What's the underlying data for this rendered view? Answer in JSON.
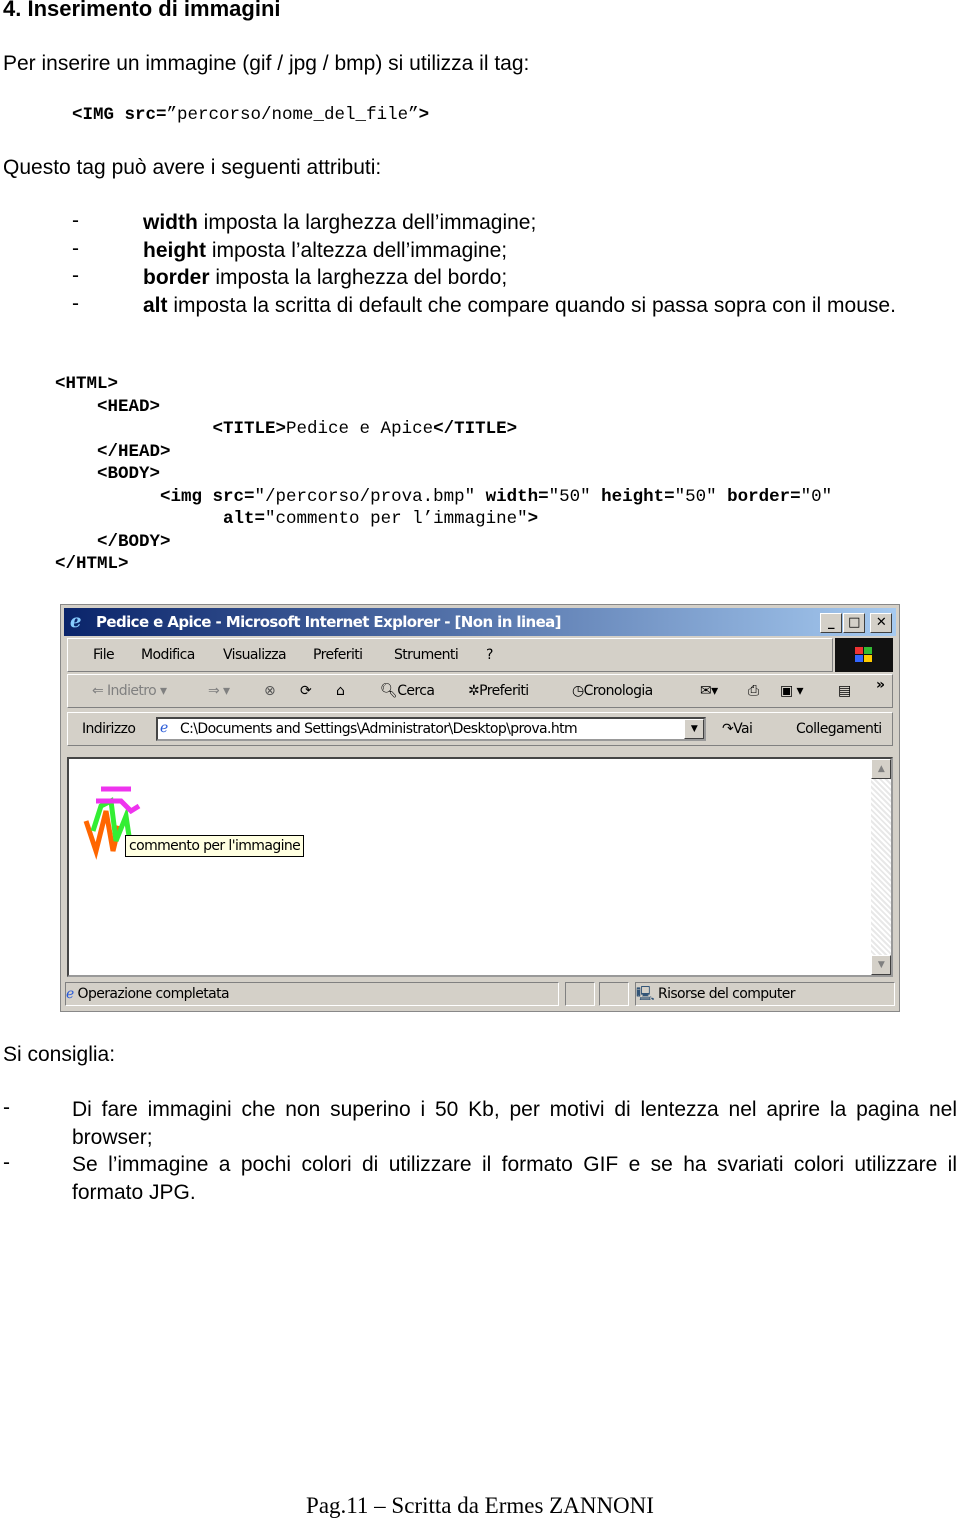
{
  "heading": "4.  Inserimento di immagini",
  "intro": "Per inserire un immagine (gif / jpg / bmp) si utilizza il tag:",
  "tag_example": [
    {
      "t": "<IMG ",
      "b": true
    },
    {
      "t": "src=",
      "b": true
    },
    {
      "t": "”percorso/nome_del_file”",
      "b": false
    },
    {
      "t": ">",
      "b": true
    }
  ],
  "attributes_intro": "Questo tag può avere i seguenti attributi:",
  "attributes": [
    {
      "dash": "-",
      "name": "width",
      "desc": " imposta la larghezza dell’immagine;"
    },
    {
      "dash": "-",
      "name": "height",
      "desc": " imposta l’altezza dell’immagine;"
    },
    {
      "dash": "-",
      "name": "border",
      "desc": " imposta la larghezza del bordo;"
    },
    {
      "dash": "-",
      "name": "alt",
      "desc": " imposta la scritta di default che compare quando si passa sopra con il mouse."
    }
  ],
  "code_lines": [
    [
      {
        "t": "<HTML>",
        "b": true
      }
    ],
    [
      {
        "t": "    <HEAD>",
        "b": true
      }
    ],
    [
      {
        "t": "               <TITLE>",
        "b": true
      },
      {
        "t": "Pedice e Apice",
        "b": false
      },
      {
        "t": "</TITLE>",
        "b": true
      }
    ],
    [
      {
        "t": "    </HEAD>",
        "b": true
      }
    ],
    [
      {
        "t": "    <BODY>",
        "b": true
      }
    ],
    [
      {
        "t": "          <img src=",
        "b": true
      },
      {
        "t": "\"/percorso/prova.bmp\" ",
        "b": false
      },
      {
        "t": "width=",
        "b": true
      },
      {
        "t": "\"50\" ",
        "b": false
      },
      {
        "t": "height=",
        "b": true
      },
      {
        "t": "\"50\" ",
        "b": false
      },
      {
        "t": "border=",
        "b": true
      },
      {
        "t": "\"0\"",
        "b": false
      }
    ],
    [
      {
        "t": "                alt=",
        "b": true
      },
      {
        "t": "\"commento per l’immagine\"",
        "b": false
      },
      {
        "t": ">",
        "b": true
      }
    ],
    [
      {
        "t": "    </BODY>",
        "b": true
      }
    ],
    [
      {
        "t": "</HTML>",
        "b": true
      }
    ]
  ],
  "browser": {
    "title": "Pedice e Apice - Microsoft Internet Explorer - [Non in linea]",
    "title_color": "#0a246a",
    "menu": [
      "File",
      "Modifica",
      "Visualizza",
      "Preferiti",
      "Strumenti",
      "?"
    ],
    "toolbar": {
      "back": "Indietro",
      "search": "Cerca",
      "favorites": "Preferiti",
      "history": "Cronologia",
      "more": "»"
    },
    "address_label": "Indirizzo",
    "address_value": "C:\\Documents and Settings\\Administrator\\Desktop\\prova.htm",
    "go": "Vai",
    "links": "Collegamenti",
    "tooltip": "commento per l'immagine",
    "status": "Operazione completata",
    "zone": "Risorse del computer"
  },
  "advice_intro": "Si consiglia:",
  "advice": [
    {
      "dash": "-",
      "text": "Di fare immagini che non superino i 50 Kb, per motivi di lentezza nel aprire la pagina nel browser;"
    },
    {
      "dash": "-",
      "text": "Se l’immagine a pochi colori di utilizzare il formato GIF e se ha svariati colori utilizzare il formato JPG."
    }
  ],
  "footer": "Pag.11 – Scritta da Ermes ZANNONI"
}
